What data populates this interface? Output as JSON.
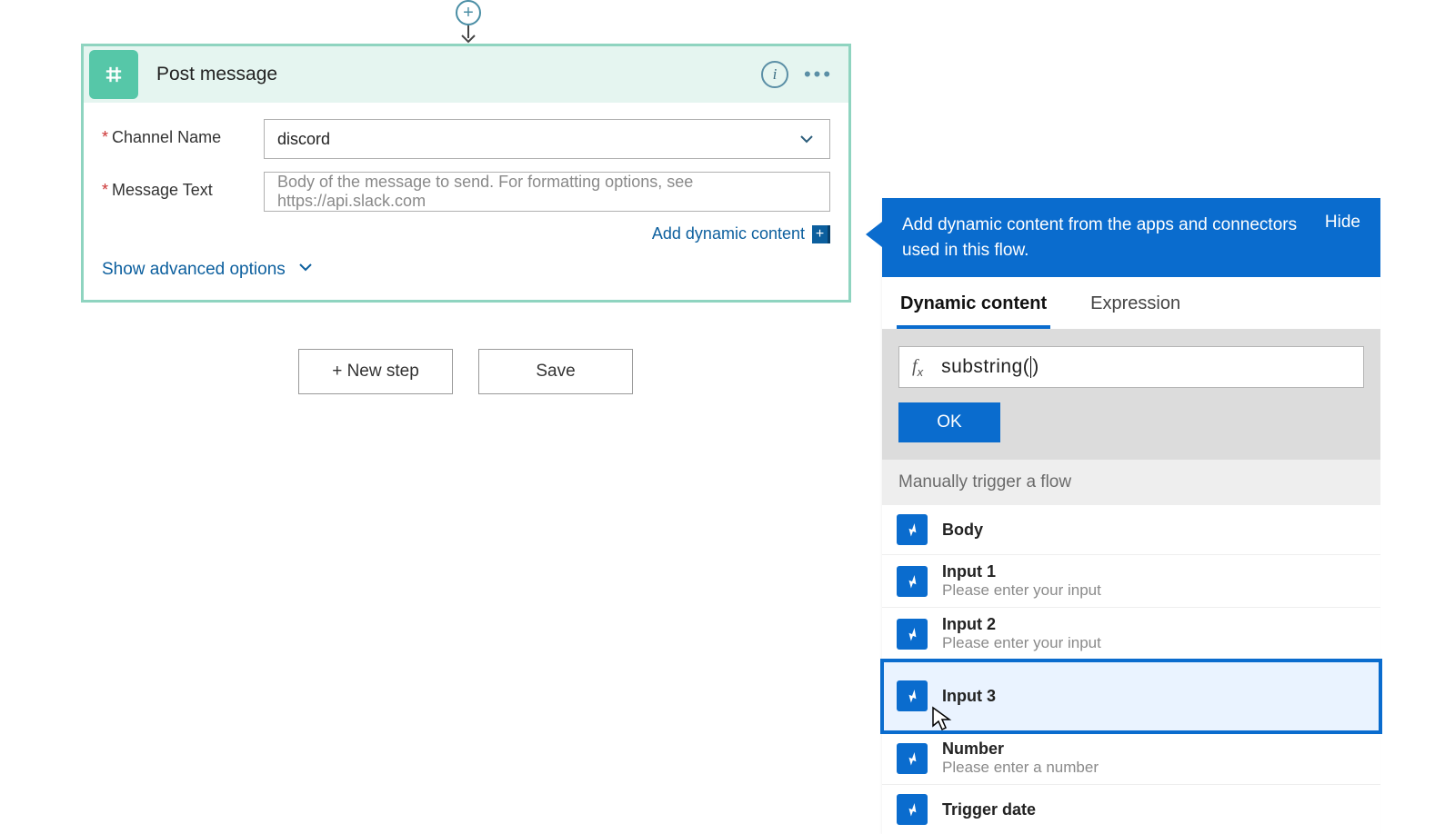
{
  "connector": {
    "plus": "+"
  },
  "card": {
    "title": "Post message",
    "fields": {
      "channel_label": "Channel Name",
      "channel_value": "discord",
      "message_label": "Message Text",
      "message_placeholder": "Body of the message to send. For formatting options, see https://api.slack.com"
    },
    "add_dynamic": "Add dynamic content",
    "show_advanced": "Show advanced options"
  },
  "footer": {
    "new_step": "+ New step",
    "save": "Save"
  },
  "dc": {
    "header_text": "Add dynamic content from the apps and connectors used in this flow.",
    "hide": "Hide",
    "tab_dynamic": "Dynamic content",
    "tab_expression": "Expression",
    "expr_before": "substring(",
    "expr_after": ")",
    "ok": "OK",
    "section": "Manually trigger a flow",
    "items": [
      {
        "title": "Body",
        "sub": ""
      },
      {
        "title": "Input 1",
        "sub": "Please enter your input"
      },
      {
        "title": "Input 2",
        "sub": "Please enter your input"
      },
      {
        "title": "Input 3",
        "sub": ""
      },
      {
        "title": "Number",
        "sub": "Please enter a number"
      },
      {
        "title": "Trigger date",
        "sub": ""
      }
    ]
  }
}
